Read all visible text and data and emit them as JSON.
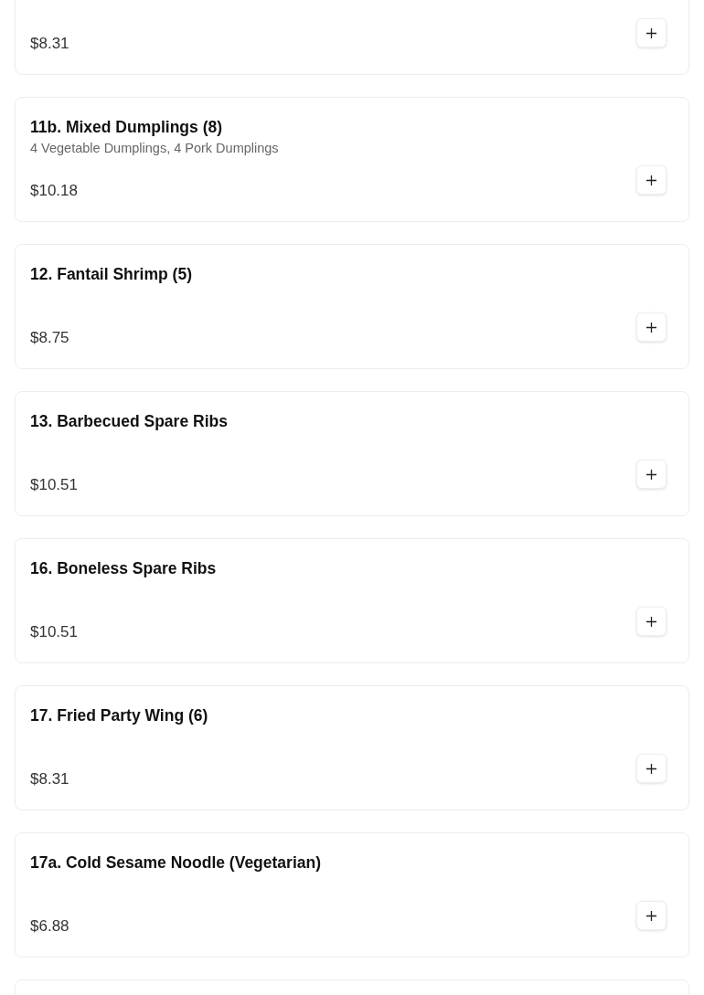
{
  "items": [
    {
      "price": "$8.31"
    },
    {
      "name": "11b. Mixed Dumplings (8)",
      "description": "4 Vegetable Dumplings, 4 Pork Dumplings",
      "price": "$10.18"
    },
    {
      "name": "12. Fantail Shrimp (5)",
      "price": "$8.75"
    },
    {
      "name": "13. Barbecued Spare Ribs",
      "price": "$10.51"
    },
    {
      "name": "16. Boneless Spare Ribs",
      "price": "$10.51"
    },
    {
      "name": "17. Fried Party Wing (6)",
      "price": "$8.31"
    },
    {
      "name": "17a. Cold Sesame Noodle (Vegetarian)",
      "price": "$6.88"
    }
  ]
}
